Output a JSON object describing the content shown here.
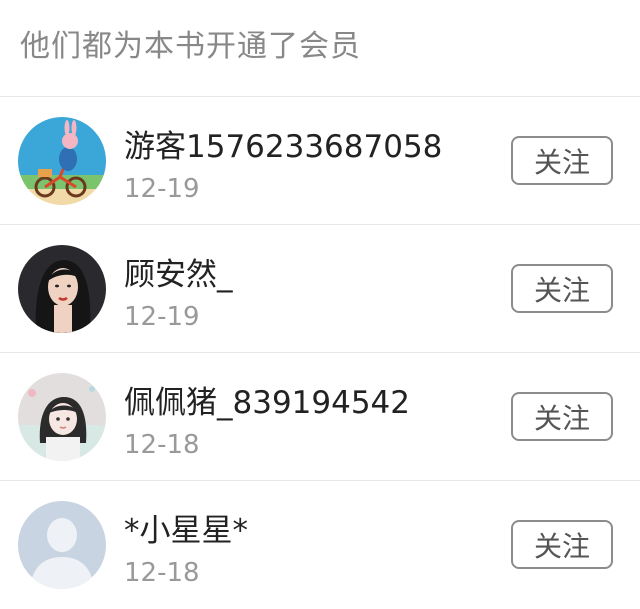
{
  "header": {
    "title": "他们都为本书开通了会员"
  },
  "members": [
    {
      "name": "游客1576233687058",
      "date": "12-19",
      "follow_label": "关注",
      "avatar": "cartoon-bunny-bicycle-avatar"
    },
    {
      "name": "顾安然_",
      "date": "12-19",
      "follow_label": "关注",
      "avatar": "girl-portrait-avatar"
    },
    {
      "name": "佩佩猪_839194542",
      "date": "12-18",
      "follow_label": "关注",
      "avatar": "pastel-girl-avatar"
    },
    {
      "name": "*小星星*",
      "date": "12-18",
      "follow_label": "关注",
      "avatar": "default-user-avatar"
    }
  ],
  "colors": {
    "divider": "#e6e6e6",
    "header_text": "#888888",
    "date_text": "#999999",
    "button_border": "#8c8c8c"
  }
}
